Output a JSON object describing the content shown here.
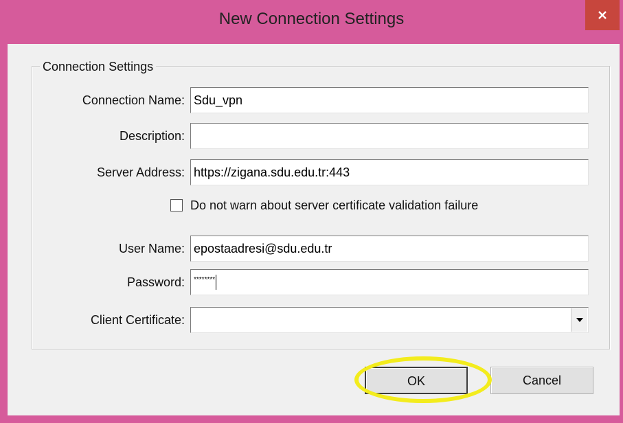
{
  "window": {
    "title": "New Connection Settings",
    "close_glyph": "✕",
    "frame_color": "#d65b9b"
  },
  "group": {
    "legend": "Connection Settings"
  },
  "fields": {
    "connection_name": {
      "label": "Connection Name:",
      "value": "Sdu_vpn"
    },
    "description": {
      "label": "Description:",
      "value": ""
    },
    "server_address": {
      "label": "Server Address:",
      "value": "https://zigana.sdu.edu.tr:443"
    },
    "user_name": {
      "label": "User Name:",
      "value": "epostaadresi@sdu.edu.tr"
    },
    "password": {
      "label": "Password:",
      "value": "********"
    },
    "client_certificate": {
      "label": "Client Certificate:",
      "value": ""
    }
  },
  "checkbox": {
    "label": "Do not warn about server certificate validation failure",
    "checked": false
  },
  "buttons": {
    "ok": "OK",
    "cancel": "Cancel"
  },
  "annotation": {
    "highlight_color": "#f3ec1d",
    "target": "ok-button"
  }
}
